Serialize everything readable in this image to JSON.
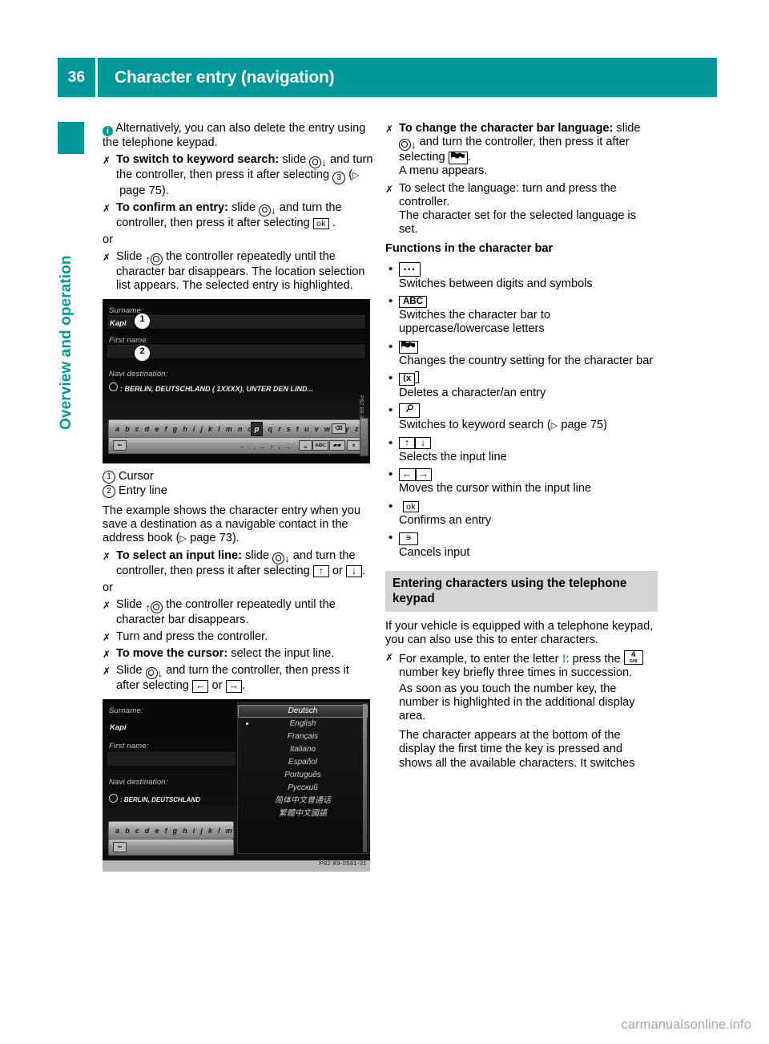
{
  "header": {
    "page_number": "36",
    "title": "Character entry (navigation)"
  },
  "chapter_tab": {
    "label": "Overview and operation"
  },
  "left_column": {
    "note": {
      "icon": "info-icon",
      "text": "Alternatively, you can also delete the entry using the telephone keypad."
    },
    "steps": [
      {
        "lead": "To switch to keyword search:",
        "text_a": "slide",
        "text_b": "and turn the controller, then press it after selecting",
        "circled": "3",
        "page_ref": "page 75",
        "tail": "."
      },
      {
        "lead": "To confirm an entry:",
        "text_a": "slide",
        "text_b": "and turn the controller, then press it after selecting",
        "key": "ok",
        "tail": "."
      }
    ],
    "or_1": "or",
    "step_slide_up_1": {
      "text_a": "Slide",
      "text_b": "the controller repeatedly until the character bar disappears.",
      "result": "The location selection list appears. The selected entry is highlighted."
    },
    "legend": [
      {
        "num": "1",
        "label": "Cursor"
      },
      {
        "num": "2",
        "label": "Entry line"
      }
    ],
    "example_text_a": "The example shows the character entry when you save a destination as a navigable contact in the address book (",
    "example_page_ref": "page 73",
    "example_text_b": ").",
    "step_select_input_line": {
      "lead": "To select an input line:",
      "text_a": "slide",
      "text_b": "and turn the controller, then press it after selecting",
      "key_up": "↑",
      "or": "or",
      "key_down": "↓",
      "tail": "."
    },
    "or_2": "or",
    "step_slide_up_2": {
      "text_a": "Slide",
      "text_b": "the controller repeatedly until the character bar disappears."
    },
    "step_turn_press": "Turn and press the controller.",
    "step_move_cursor": {
      "lead": "To move the cursor:",
      "text": "select the input line."
    },
    "step_slide_select": {
      "text_a": "Slide",
      "text_b": "and turn the controller, then press it after selecting",
      "key_left": "←",
      "or": "or",
      "key_right": "→",
      "tail": "."
    }
  },
  "figure_1": {
    "name": "address-book-character-entry-screen",
    "labels": {
      "surname": "Surname:",
      "first_name": "First name:",
      "navi_destination": "Navi destination:"
    },
    "values": {
      "surname": "Kapi",
      "first_name": ""
    },
    "destination": ": BERLIN, DEUTSCHLAND ( 1XXXX), UNTER DEN LIND...",
    "charbar_letters": "a b c d e f g h i j k l m n o p q r s t u v w x y z",
    "cursor_letter": "p",
    "callouts": [
      "1",
      "2"
    ],
    "minikeys": [
      "ABC",
      "ok",
      "x"
    ],
    "bottom_symbols": "- . , ← ↑ ↓ →",
    "side_code": "P82.89-3"
  },
  "figure_2": {
    "name": "character-bar-language-menu-screen",
    "labels": {
      "surname": "Surname:",
      "first_name": "First name:",
      "navi_destination": "Navi destination:"
    },
    "values": {
      "surname": "Kapi"
    },
    "destination": ": BERLIN, DEUTSCHLAND",
    "charbar_letters": "a b c d e f g h i j k l m n o",
    "languages": [
      "Deutsch",
      "English",
      "Français",
      "Italiano",
      "Español",
      "Português",
      "Русский",
      "简体中文普通话",
      "繁體中文國語"
    ],
    "selected_language": "Deutsch",
    "active_marker_language": "English",
    "code": "P82.89-0581-31"
  },
  "right_column": {
    "step_change_language": {
      "lead": "To change the character bar language:",
      "text_a": "slide",
      "text_b": "and turn the controller, then press it after selecting",
      "key": "flag-icon",
      "tail": ".",
      "result": "A menu appears."
    },
    "step_select_language": {
      "text": "To select the language: turn and press the controller.",
      "result": "The character set for the selected language is set."
    },
    "functions_heading": "Functions in the character bar",
    "functions": [
      {
        "icon": "dots-icon",
        "glyph": "• • •",
        "desc": "Switches between digits and symbols"
      },
      {
        "icon": "abc-icon",
        "glyph": "ABC",
        "desc": "Switches the character bar to uppercase/lowercase letters"
      },
      {
        "icon": "flag-icon",
        "glyph": "flag",
        "desc": "Changes the country setting for the character bar"
      },
      {
        "icon": "backspace-icon",
        "glyph": "⌫",
        "desc": "Deletes a character/an entry"
      },
      {
        "icon": "magnifier-icon",
        "glyph": "magnifier",
        "desc": "Switches to keyword search (",
        "page_ref": "page 75",
        "desc_tail": ")"
      },
      {
        "icon": "up-down-arrows-icon",
        "glyph": "↑ ↓",
        "desc": "Selects the input line"
      },
      {
        "icon": "left-right-arrows-icon",
        "glyph": "← →",
        "desc": "Moves the cursor within the input line"
      },
      {
        "icon": "ok-icon",
        "glyph": "ok",
        "desc": "Confirms an entry"
      },
      {
        "icon": "back-icon",
        "glyph": "⤺",
        "desc": "Cancels input"
      }
    ],
    "section_heading": "Entering characters using the telephone keypad",
    "intro": "If your vehicle is equipped with a telephone keypad, you can also use this to enter characters.",
    "example_step": {
      "text_a": "For example, to enter the letter",
      "letter": "I",
      "text_b": ": press the",
      "keypad_digit": "4",
      "keypad_letters": "GHI",
      "text_c": "number key briefly three times in succession."
    },
    "paragraph_1": "As soon as you touch the number key, the number is highlighted in the additional display area.",
    "paragraph_2": "The character appears at the bottom of the display the first time the key is pressed and shows all the available characters. It switches"
  },
  "watermark": "carmanualsonline.info",
  "colors": {
    "teal": "#00979a",
    "grey_band": "#d5d5d5",
    "watermark_grey": "#a7a7a7"
  }
}
